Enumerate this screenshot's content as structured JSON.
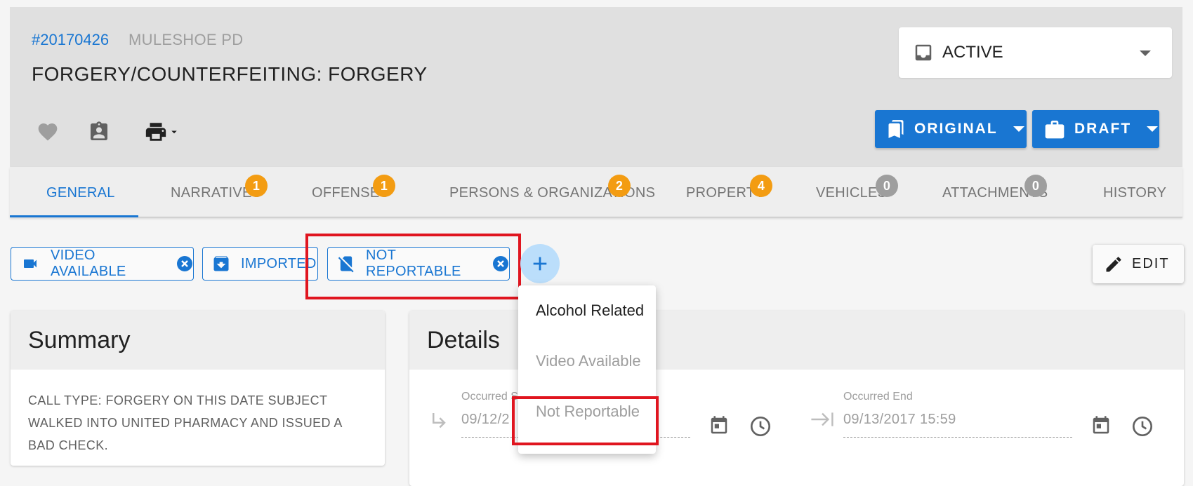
{
  "header": {
    "case_number": "#20170426",
    "agency": "MULESHOE PD",
    "title": "FORGERY/COUNTERFEITING: FORGERY",
    "status": "ACTIVE",
    "original_label": "ORIGINAL",
    "draft_label": "DRAFT"
  },
  "tabs": [
    {
      "label": "GENERAL",
      "badge": null,
      "active": true
    },
    {
      "label": "NARRATIVES",
      "badge": "1",
      "badge_color": "orange"
    },
    {
      "label": "OFFENSES",
      "badge": "1",
      "badge_color": "orange"
    },
    {
      "label": "PERSONS & ORGANIZATIONS",
      "badge": "2",
      "badge_color": "orange"
    },
    {
      "label": "PROPERTY",
      "badge": "4",
      "badge_color": "orange"
    },
    {
      "label": "VEHICLES",
      "badge": "0",
      "badge_color": "grey"
    },
    {
      "label": "ATTACHMENTS",
      "badge": "0",
      "badge_color": "grey"
    },
    {
      "label": "HISTORY",
      "badge": null
    }
  ],
  "tags": {
    "items": [
      {
        "label": "VIDEO AVAILABLE",
        "icon": "videocam-icon",
        "removable": true
      },
      {
        "label": "IMPORTED",
        "icon": "archive-icon",
        "removable": false
      },
      {
        "label": "NOT REPORTABLE",
        "icon": "no-sim-icon",
        "removable": true
      }
    ]
  },
  "edit_label": "EDIT",
  "summary": {
    "title": "Summary",
    "text": "CALL TYPE: FORGERY ON THIS DATE SUBJECT WALKED INTO UNITED PHARMACY AND ISSUED A BAD CHECK."
  },
  "details": {
    "title": "Details",
    "occurred_start_label": "Occurred S",
    "occurred_start_value": "09/12/2",
    "occurred_end_label": "Occurred End",
    "occurred_end_value": "09/13/2017 15:59"
  },
  "tag_menu": {
    "items": [
      {
        "label": "Alcohol Related",
        "enabled": true
      },
      {
        "label": "Video Available",
        "enabled": false
      },
      {
        "label": "Not Reportable",
        "enabled": false
      }
    ]
  },
  "colors": {
    "primary": "#1976d2",
    "badge_orange": "#f39c12",
    "badge_grey": "#9e9e9e",
    "highlight": "#e0151f"
  }
}
